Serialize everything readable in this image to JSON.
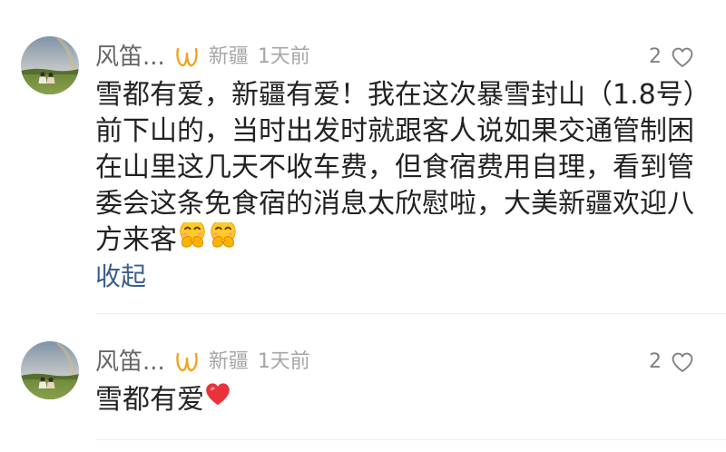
{
  "comments": [
    {
      "avatar_icon": "avatar-photo-icon",
      "username": "风笛...",
      "badge_icon": "orange-badge-icon",
      "location": "新疆",
      "time": "1天前",
      "like_count": "2",
      "like_icon": "heart-outline-icon",
      "text_lines": [
        "雪都有爱，新疆有爱！我在这次暴雪封山（1.8号）",
        "前下山的，当时出发时就跟客人说如果交通管制困",
        "在山里这几天不收车费，但食宿费用自理，看到管",
        "委会这条免食宿的消息太欣慰啦，大美新疆欢迎八",
        "方来客"
      ],
      "trailing_emojis": [
        "hand-over-mouth-emoji",
        "hand-over-mouth-emoji"
      ],
      "collapse_label": "收起"
    },
    {
      "avatar_icon": "avatar-photo-icon",
      "username": "风笛...",
      "badge_icon": "orange-badge-icon",
      "location": "新疆",
      "time": "1天前",
      "like_count": "2",
      "like_icon": "heart-outline-icon",
      "text_lines": [
        "雪都有爱"
      ],
      "trailing_emojis": [
        "red-heart-emoji"
      ]
    }
  ],
  "colors": {
    "text_primary": "#222222",
    "username": "#666666",
    "meta": "#a6a6a6",
    "link": "#3b5d8f",
    "badge": "#f5a21c",
    "divider": "#ededed",
    "like": "#808080",
    "heart_emoji": "#e8333b"
  }
}
